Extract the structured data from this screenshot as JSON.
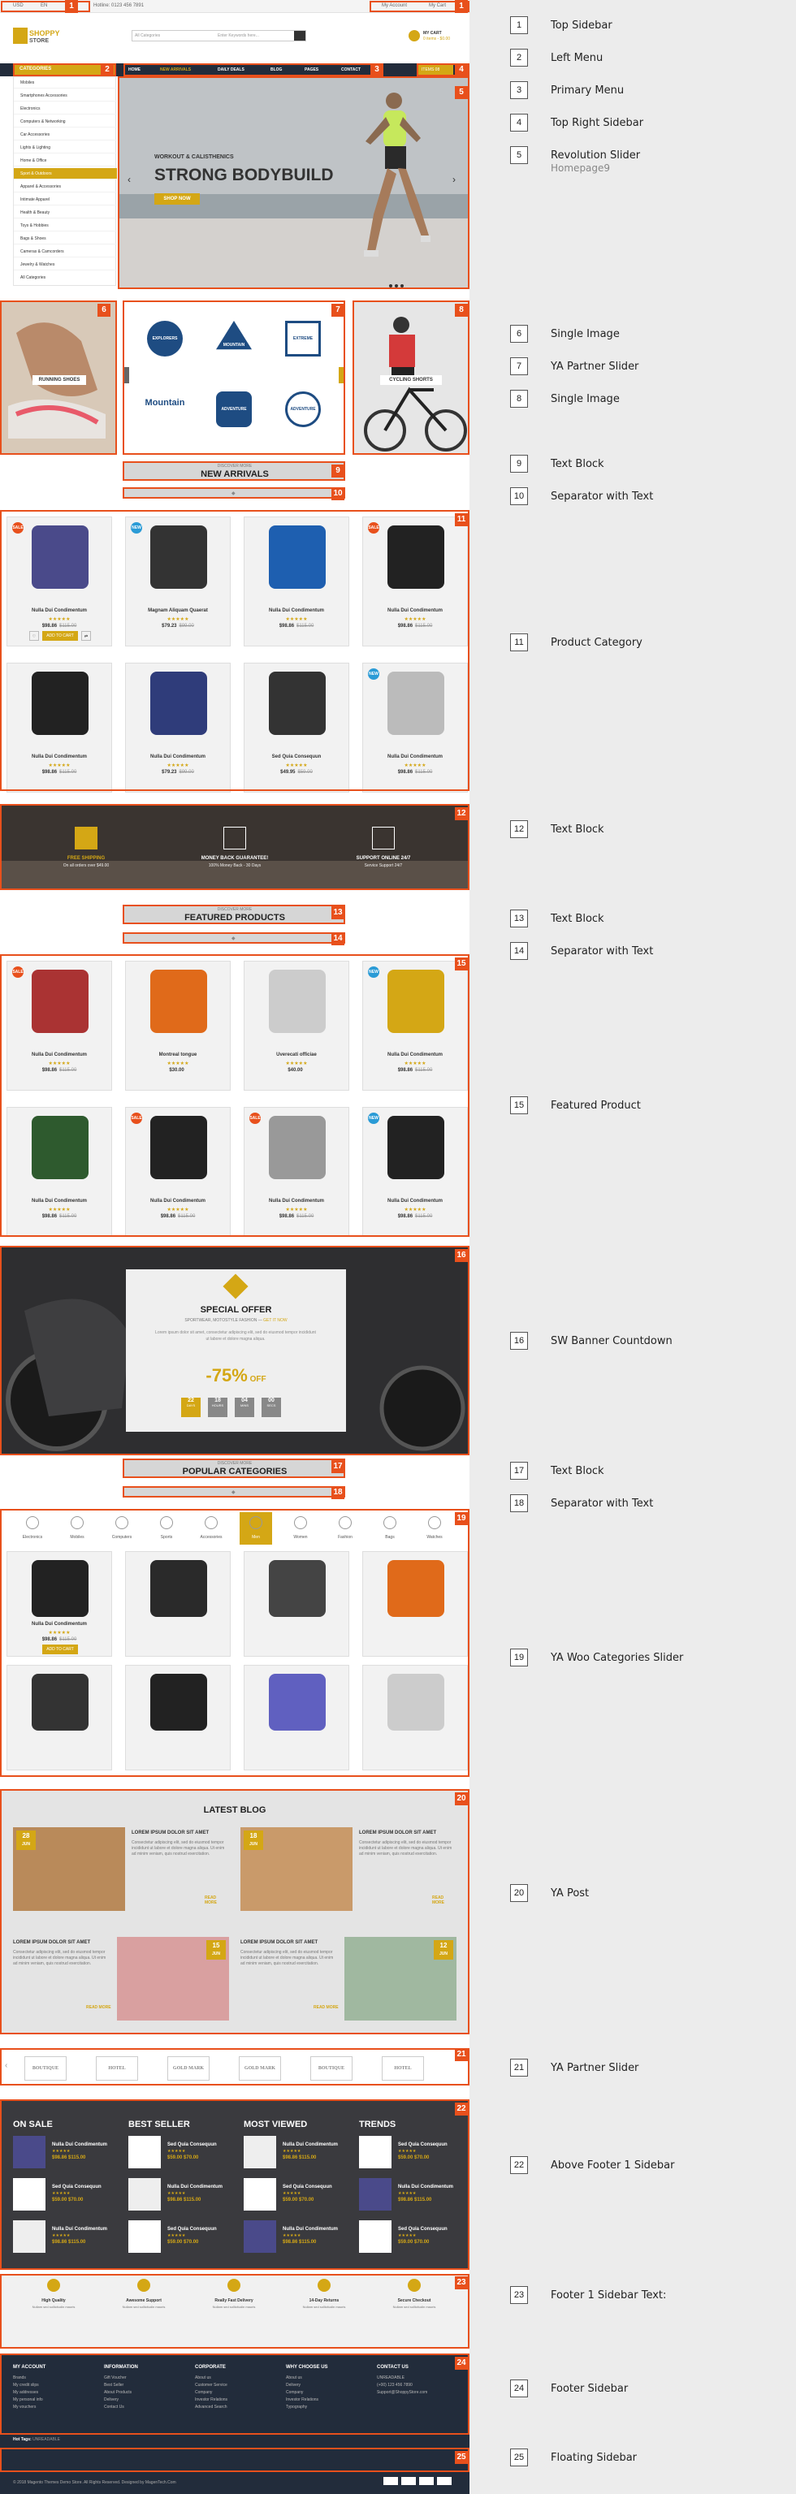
{
  "topbar": {
    "currency": "USD",
    "lang": "EN",
    "phone": "Hotline: 0123 456 7891",
    "account": "My Account",
    "cart": "My Cart"
  },
  "header": {
    "logo_top": "SHOPPY",
    "logo_bottom": "STORE",
    "search_category": "All Categories",
    "search_placeholder": "Enter Keywords here...",
    "cart_label": "MY CART",
    "cart_sub": "0 items - $0.00"
  },
  "nav": {
    "categories": "CATEGORIES",
    "items": [
      "HOME",
      "NEW ARRIVALS",
      "DAILY DEALS",
      "BLOG",
      "PAGES",
      "CONTACT"
    ],
    "button": "ITEMS 08"
  },
  "sidemenu": [
    "Mobiles",
    "Smartphones Accessories",
    "Electronics",
    "Computers & Networking",
    "Car Accessories",
    "Lights & Lighting",
    "Home & Office",
    "Sport & Outdoors",
    "Apparel & Accessories",
    "Intimate Apparel",
    "Health & Beauty",
    "Toys & Hobbies",
    "Bags & Shoes",
    "Cameras & Camcorders",
    "Jewelry & Watches",
    "All Categories"
  ],
  "slider": {
    "kicker": "WORKOUT & CALISTHENICS",
    "title": "STRONG BODYBUILD",
    "button": "SHOP NOW"
  },
  "images": {
    "running": "RUNNING SHOES",
    "cycling": "CYCLING SHORTS"
  },
  "partners_a": [
    "EXPLORERS",
    "MOUNTAIN",
    "EXTREME",
    "Mountain",
    "ADVENTURE",
    "ADVENTURE"
  ],
  "sections": {
    "new_arrivals_sub": "DISCOVER MORE",
    "new_arrivals": "NEW ARRIVALS",
    "featured_sub": "DISCOVER MORE",
    "featured": "FEATURED PRODUCTS",
    "popular_sub": "DISCOVER MORE",
    "popular": "POPULAR CATEGORIES",
    "blog": "LATEST BLOG"
  },
  "products_a": [
    {
      "name": "Nulla Dui Condimentum",
      "price": "$98.86",
      "old": "$115.00",
      "badge": "SALE"
    },
    {
      "name": "Magnam Aliquam Quaerat",
      "price": "$79.23",
      "old": "$99.00",
      "badge": "NEW"
    },
    {
      "name": "Nulla Dui Condimentum",
      "price": "$98.86",
      "old": "$115.00",
      "badge": ""
    },
    {
      "name": "Nulla Dui Condimentum",
      "price": "$98.86",
      "old": "$115.00",
      "badge": "SALE"
    },
    {
      "name": "Nulla Dui Condimentum",
      "price": "$98.86",
      "old": "$115.00",
      "badge": ""
    },
    {
      "name": "Nulla Dui Condimentum",
      "price": "$79.23",
      "old": "$99.00",
      "badge": ""
    },
    {
      "name": "Sed Quia Consequun",
      "price": "$49.95",
      "old": "$59.00",
      "badge": ""
    },
    {
      "name": "Nulla Dui Condimentum",
      "price": "$98.86",
      "old": "$115.00",
      "badge": "NEW"
    }
  ],
  "card_buttons": {
    "add": "ADD TO CART"
  },
  "features": [
    {
      "t1": "FREE SHIPPING",
      "t2": "On all orders over $49.00"
    },
    {
      "t1": "MONEY BACK GUARANTEE!",
      "t2": "100% Money Back - 30 Days"
    },
    {
      "t1": "SUPPORT ONLINE 24/7",
      "t2": "Service Support 24/7"
    }
  ],
  "products_b": [
    {
      "name": "Nulla Dui Condimentum",
      "price": "$98.86",
      "old": "$115.00",
      "badge": "SALE"
    },
    {
      "name": "Montreal tongue",
      "price": "$30.00",
      "old": "",
      "badge": ""
    },
    {
      "name": "Uverecati officiae",
      "price": "$40.00",
      "old": "",
      "badge": ""
    },
    {
      "name": "Nulla Dui Condimentum",
      "price": "$98.86",
      "old": "$115.00",
      "badge": "NEW"
    },
    {
      "name": "Nulla Dui Condimentum",
      "price": "$98.86",
      "old": "$115.00",
      "badge": ""
    },
    {
      "name": "Nulla Dui Condimentum",
      "price": "$98.86",
      "old": "$115.00",
      "badge": "SALE"
    },
    {
      "name": "Nulla Dui Condimentum",
      "price": "$98.86",
      "old": "$115.00",
      "badge": "SALE"
    },
    {
      "name": "Nulla Dui Condimentum",
      "price": "$98.86",
      "old": "$115.00",
      "badge": "NEW"
    }
  ],
  "offer": {
    "title": "SPECIAL OFFER",
    "sub": "SPORTWEAR, MOTOSTYLE FASHION",
    "sub2": "GET IT NOW",
    "text": "Lorem ipsum dolor sit amet, consectetur adipiscing elit, sed do eiusmod tempor incididunt ut labore et dolore magna aliqua.",
    "discount": "-75%",
    "off": "OFF",
    "count": [
      {
        "v": "22",
        "l": "DAYS"
      },
      {
        "v": "18",
        "l": "HOURS"
      },
      {
        "v": "04",
        "l": "MINS"
      },
      {
        "v": "00",
        "l": "SECS"
      }
    ]
  },
  "cat_tabs": [
    "Electronics",
    "Mobiles",
    "Computers",
    "Sports",
    "Accessories",
    "Men",
    "Women",
    "Fashion",
    "Bags",
    "Watches"
  ],
  "popular_product": {
    "name": "Nulla Dui Condimentum",
    "price": "$98.86",
    "old": "$115.00"
  },
  "blog": [
    {
      "day": "28",
      "mon": "JUN",
      "title": "LOREM IPSUM DOLOR SIT AMET",
      "text": "Consectetur adipiscing elit, sed do eiusmod tempor incididunt ut labore et dolore magna aliqua. Ut enim ad minim veniam, quis nostrud exercitation.",
      "more": "READ MORE"
    },
    {
      "day": "18",
      "mon": "JUN",
      "title": "LOREM IPSUM DOLOR SIT AMET",
      "text": "Consectetur adipiscing elit, sed do eiusmod tempor incididunt ut labore et dolore magna aliqua. Ut enim ad minim veniam, quis nostrud exercitation.",
      "more": "READ MORE"
    },
    {
      "day": "15",
      "mon": "JUN",
      "title": "LOREM IPSUM DOLOR SIT AMET",
      "text": "Consectetur adipiscing elit, sed do eiusmod tempor incididunt ut labore et dolore magna aliqua. Ut enim ad minim veniam, quis nostrud exercitation.",
      "more": "READ MORE"
    },
    {
      "day": "12",
      "mon": "JUN",
      "title": "LOREM IPSUM DOLOR SIT AMET",
      "text": "Consectetur adipiscing elit, sed do eiusmod tempor incididunt ut labore et dolore magna aliqua. Ut enim ad minim veniam, quis nostrud exercitation.",
      "more": "READ MORE"
    }
  ],
  "partners_b": [
    "BOUTIQUE",
    "HOTEL",
    "GOLD MARK",
    "GOLD MARK",
    "BOUTIQUE",
    "HOTEL"
  ],
  "footer_cols": {
    "heads": [
      "ON SALE",
      "BEST SELLER",
      "MOST VIEWED",
      "TRENDS"
    ],
    "items": [
      {
        "n": "Nulla Dui Condimentum",
        "p": "$98.86 $115.00"
      },
      {
        "n": "Sed Quia Consequun",
        "p": "$59.00 $70.00"
      },
      {
        "n": "Nulla Dui Condimentum",
        "p": "$98.86 $115.00"
      },
      {
        "n": "Sed Quia Consequun",
        "p": "$59.00 $70.00"
      }
    ],
    "stars": "★★★★★"
  },
  "footer_bar": [
    {
      "t": "High Quality",
      "d": "Nullam sed sollicitudin mauris"
    },
    {
      "t": "Awesome Support",
      "d": "Nullam sed sollicitudin mauris"
    },
    {
      "t": "Really Fast Delivery",
      "d": "Nullam sed sollicitudin mauris"
    },
    {
      "t": "14-Day Returns",
      "d": "Nullam sed sollicitudin mauris"
    },
    {
      "t": "Secure Checkout",
      "d": "Nullam sed sollicitudin mauris"
    }
  ],
  "footer": {
    "cols": [
      {
        "h": "MY ACCOUNT",
        "i": [
          "Brands",
          "My credit slips",
          "My addresses",
          "My personal info",
          "My vouchers"
        ]
      },
      {
        "h": "INFORMATION",
        "i": [
          "Gift Voucher",
          "Best Seller",
          "About Products",
          "Delivery",
          "Contact Us"
        ]
      },
      {
        "h": "CORPORATE",
        "i": [
          "About us",
          "Customer Service",
          "Company",
          "Investor Relations",
          "Advanced Search"
        ]
      },
      {
        "h": "WHY CHOOSE US",
        "i": [
          "About us",
          "Delivery",
          "Company",
          "Investor Relations",
          "Typography"
        ]
      },
      {
        "h": "CONTACT US",
        "i": [
          "UNREADABLE",
          "(+00) 123 456 7890",
          "Support@ShoppyStore.com"
        ]
      }
    ],
    "hot_tags_label": "Hot Tags:",
    "hot_tags": "UNREADABLE",
    "copyright": "© 2018 Magento Themes Demo Store. All Rights Reserved. Designed by MagenTech.Com"
  },
  "legend": [
    {
      "n": "1",
      "t": "Top Sidebar"
    },
    {
      "n": "2",
      "t": "Left Menu"
    },
    {
      "n": "3",
      "t": "Primary Menu"
    },
    {
      "n": "4",
      "t": "Top Right Sidebar"
    },
    {
      "n": "5",
      "t": "Revolution Slider",
      "s": "Homepage9"
    },
    {
      "n": "6",
      "t": "Single Image"
    },
    {
      "n": "7",
      "t": "YA Partner Slider"
    },
    {
      "n": "8",
      "t": "Single Image"
    },
    {
      "n": "9",
      "t": "Text Block"
    },
    {
      "n": "10",
      "t": "Separator with Text"
    },
    {
      "n": "11",
      "t": "Product Category"
    },
    {
      "n": "12",
      "t": "Text Block"
    },
    {
      "n": "13",
      "t": "Text Block"
    },
    {
      "n": "14",
      "t": "Separator with Text"
    },
    {
      "n": "15",
      "t": "Featured Product"
    },
    {
      "n": "16",
      "t": "SW Banner Countdown"
    },
    {
      "n": "17",
      "t": "Text Block"
    },
    {
      "n": "18",
      "t": "Separator with Text"
    },
    {
      "n": "19",
      "t": "YA Woo Categories Slider"
    },
    {
      "n": "20",
      "t": "YA Post"
    },
    {
      "n": "21",
      "t": "YA Partner Slider"
    },
    {
      "n": "22",
      "t": "Above Footer 1 Sidebar"
    },
    {
      "n": "23",
      "t": "Footer 1 Sidebar Text:"
    },
    {
      "n": "24",
      "t": "Footer Sidebar"
    },
    {
      "n": "25",
      "t": "Floating Sidebar"
    }
  ],
  "colors": {
    "accent": "#d4a715",
    "marker": "#e8501c",
    "navy": "#222c3b",
    "dark": "#2f3238"
  }
}
